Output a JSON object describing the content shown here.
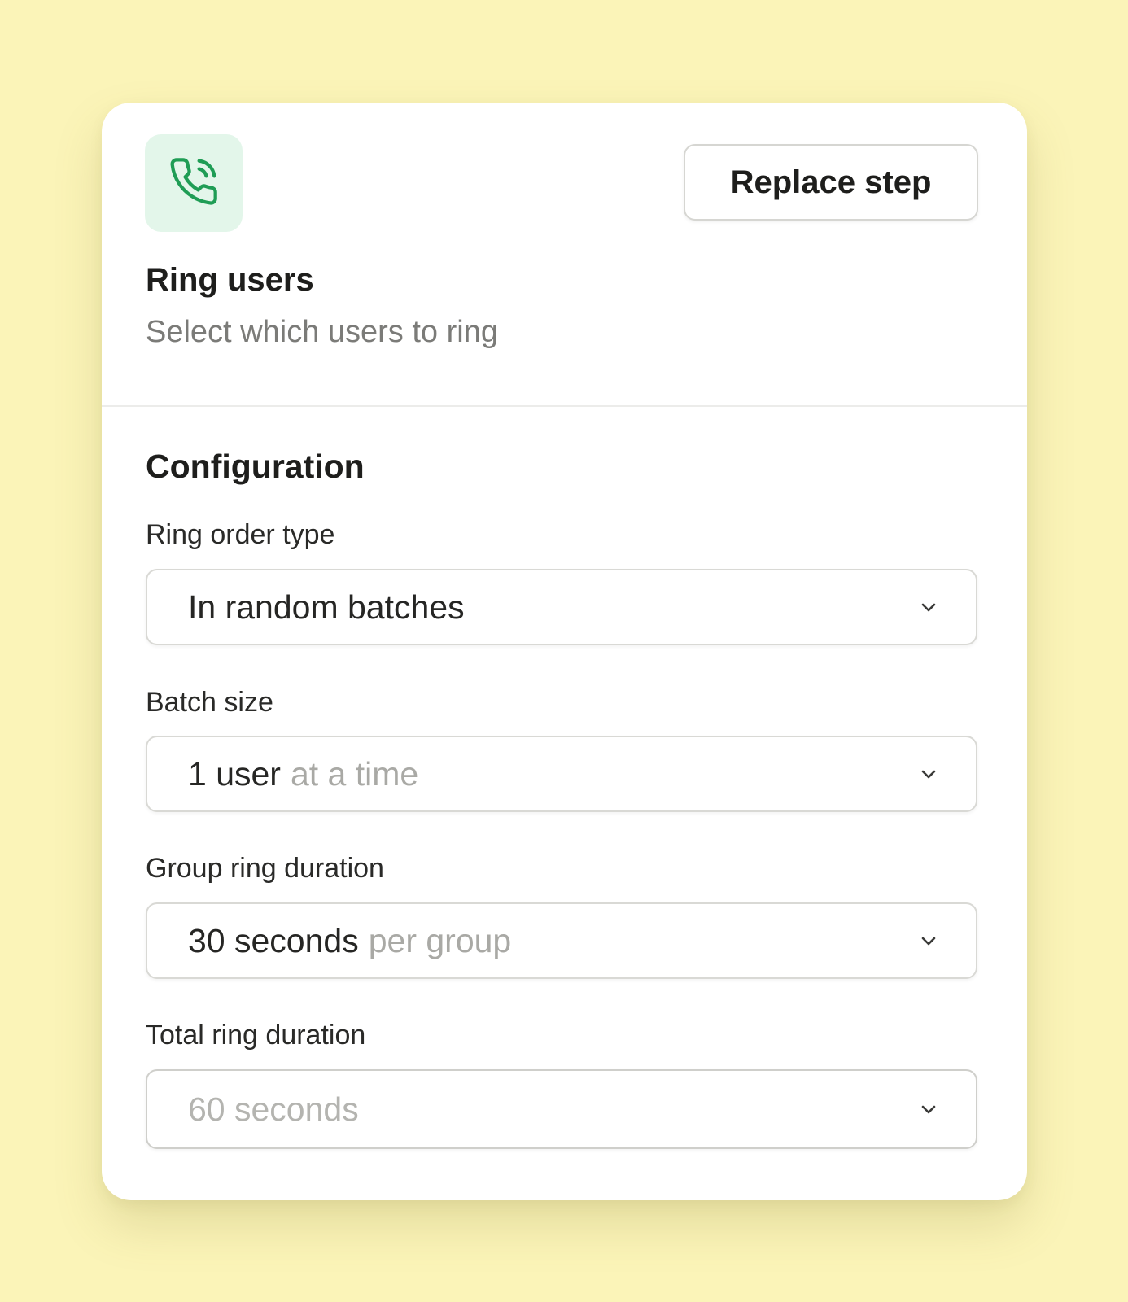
{
  "step": {
    "icon": "phone-ringing-icon",
    "title": "Ring users",
    "subtitle": "Select which users to ring",
    "replace_label": "Replace step"
  },
  "config": {
    "title": "Configuration",
    "ring_order": {
      "label": "Ring order type",
      "value": "In random batches"
    },
    "batch_size": {
      "label": "Batch size",
      "value": "1 user",
      "suffix": "at a time"
    },
    "group_duration": {
      "label": "Group ring duration",
      "value": "30 seconds",
      "suffix": "per group"
    },
    "total_duration": {
      "label": "Total ring duration",
      "value": "60 seconds"
    }
  },
  "colors": {
    "background": "#fbf4b8",
    "icon_green": "#1f9d55",
    "icon_tile": "#e3f6ea"
  }
}
